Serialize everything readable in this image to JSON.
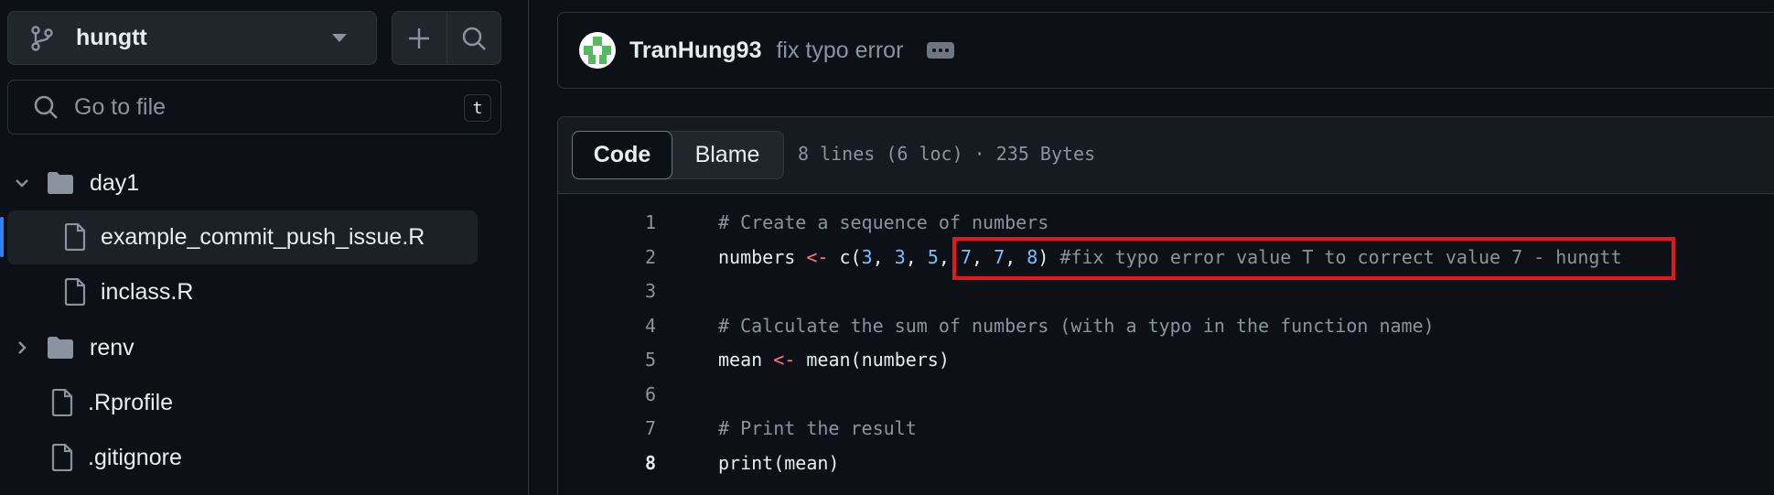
{
  "sidebar": {
    "branch": {
      "name": "hungtt"
    },
    "search": {
      "placeholder": "Go to file",
      "shortcut": "t"
    },
    "tree": [
      {
        "label": "day1",
        "type": "folder",
        "expanded": true
      },
      {
        "label": "example_commit_push_issue.R",
        "type": "file",
        "active": true
      },
      {
        "label": "inclass.R",
        "type": "file"
      },
      {
        "label": "renv",
        "type": "folder",
        "expanded": false
      },
      {
        "label": ".Rprofile",
        "type": "file"
      },
      {
        "label": ".gitignore",
        "type": "file"
      }
    ]
  },
  "commit": {
    "author": "TranHung93",
    "message": "fix typo error"
  },
  "file": {
    "tabs": {
      "code": "Code",
      "blame": "Blame"
    },
    "meta": "8 lines (6 loc) · 235 Bytes",
    "line_numbers": [
      "1",
      "2",
      "3",
      "4",
      "5",
      "6",
      "7",
      "8"
    ],
    "lines": {
      "l1_comment": "# Create a sequence of numbers",
      "l2_var": "numbers",
      "l2_op": "<-",
      "l2_call": "c(",
      "l2_n1": "3",
      "l2_n2": "3",
      "l2_n3": "5",
      "l2_n4": "7",
      "l2_n5": "7",
      "l2_n6": "8",
      "l2_sep": ",",
      "l2_close": ")",
      "l2_comment": "#fix typo error value T to correct value 7 - hungtt",
      "l4_comment": "# Calculate the sum of numbers (with a typo in the function name)",
      "l5_var": "mean",
      "l5_op": "<-",
      "l5_call": "mean(numbers)",
      "l7_comment": "# Print the result",
      "l8_call": "print(mean)"
    }
  },
  "colors": {
    "background": "#0d1117",
    "border": "#30363d",
    "accent": "#2f81f7",
    "highlight_box": "#e5171c",
    "code_number": "#79c0ff",
    "code_operator": "#ff7b72",
    "comment": "#8b949e"
  },
  "icons": [
    "git-branch-icon",
    "caret-down-icon",
    "plus-icon",
    "search-icon",
    "chevron-down-icon",
    "chevron-right-icon",
    "folder-icon",
    "file-icon",
    "avatar",
    "kebab-icon"
  ]
}
